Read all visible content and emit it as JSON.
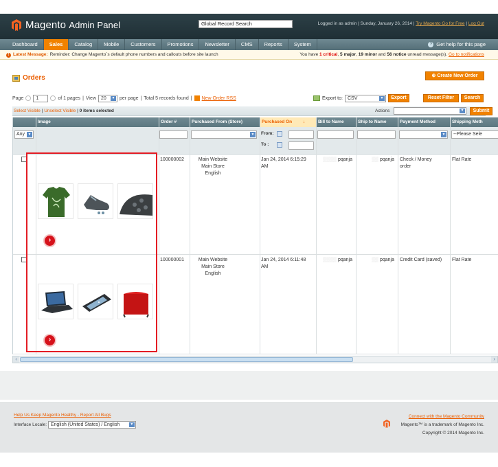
{
  "header": {
    "logo_title": "Magento",
    "logo_subtitle": "Admin Panel",
    "search_placeholder": "Global Record Search",
    "logged_in": "Logged in as admin",
    "date": "Sunday, January 26, 2014",
    "try_go": "Try Magento Go for Free",
    "logout": "Log Out"
  },
  "nav": {
    "items": [
      "Dashboard",
      "Sales",
      "Catalog",
      "Mobile",
      "Customers",
      "Promotions",
      "Newsletter",
      "CMS",
      "Reports",
      "System"
    ],
    "help": "Get help for this page"
  },
  "message": {
    "label": "Latest Message:",
    "text": "Reminder: Change Magento`s default phone numbers and callouts before site launch",
    "right_prefix": "You have",
    "critical": "1 critical",
    "major": "5 major",
    "minor": "19 minor",
    "notice": "56 notice",
    "right_suffix": "unread message(s).",
    "link": "Go to notifications"
  },
  "page": {
    "title": "Orders",
    "create_button": "Create New Order"
  },
  "pager": {
    "page_label": "Page",
    "page_value": "1",
    "of_pages": "of 1 pages",
    "view_label": "View",
    "view_value": "20",
    "per_page": "per page",
    "records": "Total 5 records found",
    "rss": "New Order RSS",
    "export_to": "Export to:",
    "export_value": "CSV",
    "export_button": "Export",
    "reset_button": "Reset Filter",
    "search_button": "Search"
  },
  "massaction": {
    "select_visible": "Select Visible",
    "unselect_visible": "Unselect Visible",
    "selected": "0 items selected",
    "actions_label": "Actions",
    "submit": "Submit"
  },
  "grid": {
    "headers": [
      "",
      "Image",
      "Order #",
      "Purchased From (Store)",
      "Purchased On",
      "Bill to Name",
      "Ship to Name",
      "Payment Method",
      "Shipping Meth"
    ],
    "filter": {
      "any": "Any",
      "from": "From:",
      "to": "To :",
      "shipping_placeholder": "--Please Sele"
    },
    "rows": [
      {
        "order": "100000002",
        "store_1": "Main Website",
        "store_2": "Main Store",
        "store_3": "English",
        "purchased": "Jan 24, 2014 6:15:29",
        "purchased_2": "AM",
        "bill": "pqanja",
        "ship": "pqanja",
        "payment": "Check / Money",
        "payment_2": "order",
        "shipping": "Flat Rate"
      },
      {
        "order": "100000001",
        "store_1": "Main Website",
        "store_2": "Main Store",
        "store_3": "English",
        "purchased": "Jan 24, 2014 6:11:48",
        "purchased_2": "AM",
        "bill": "pqanja",
        "ship": "pqanja",
        "payment": "Credit Card (saved)",
        "payment_2": "",
        "shipping": "Flat Rate"
      }
    ]
  },
  "footer": {
    "healthy": "Help Us Keep Magento Healthy - Report All Bugs",
    "locale_label": "Interface Locale:",
    "locale_value": "English (United States) / English",
    "community": "Connect with the Magento Community",
    "trademark": "Magento™ is a trademark of Magento Inc.",
    "copyright": "Copyright © 2014 Magento Inc."
  },
  "colors": {
    "accent": "#f18200",
    "header": "#2d4047",
    "highlight": "#e31b23"
  }
}
